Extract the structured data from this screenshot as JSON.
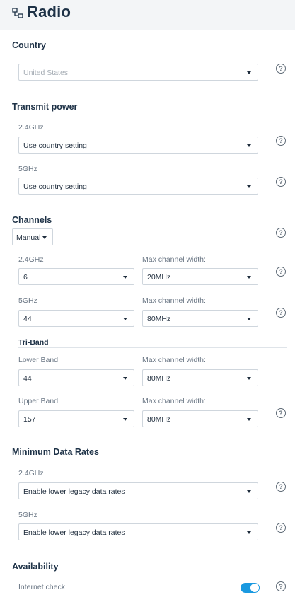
{
  "header": {
    "title": "Radio",
    "icon": "radio-settings-icon"
  },
  "country": {
    "heading": "Country",
    "value": "United States"
  },
  "transmit_power": {
    "heading": "Transmit power",
    "band_24": {
      "label": "2.4GHz",
      "value": "Use country setting"
    },
    "band_5": {
      "label": "5GHz",
      "value": "Use country setting"
    }
  },
  "channels": {
    "heading": "Channels",
    "mode": "Manual",
    "band_24": {
      "label": "2.4GHz",
      "channel": "6",
      "width_label": "Max channel width:",
      "width": "20MHz"
    },
    "band_5": {
      "label": "5GHz",
      "channel": "44",
      "width_label": "Max channel width:",
      "width": "80MHz"
    },
    "triband": {
      "heading": "Tri-Band",
      "lower": {
        "label": "Lower Band",
        "channel": "44",
        "width_label": "Max channel width:",
        "width": "80MHz"
      },
      "upper": {
        "label": "Upper Band",
        "channel": "157",
        "width_label": "Max channel width:",
        "width": "80MHz"
      }
    }
  },
  "min_rates": {
    "heading": "Minimum Data Rates",
    "band_24": {
      "label": "2.4GHz",
      "value": "Enable lower legacy data rates"
    },
    "band_5": {
      "label": "5GHz",
      "value": "Enable lower legacy data rates"
    }
  },
  "availability": {
    "heading": "Availability",
    "internet_check": {
      "label": "Internet check",
      "enabled": true
    }
  },
  "help_glyph": "?",
  "colors": {
    "accent": "#1a99e0",
    "heading": "#1e3247",
    "header_bg": "#f3f5f7"
  }
}
